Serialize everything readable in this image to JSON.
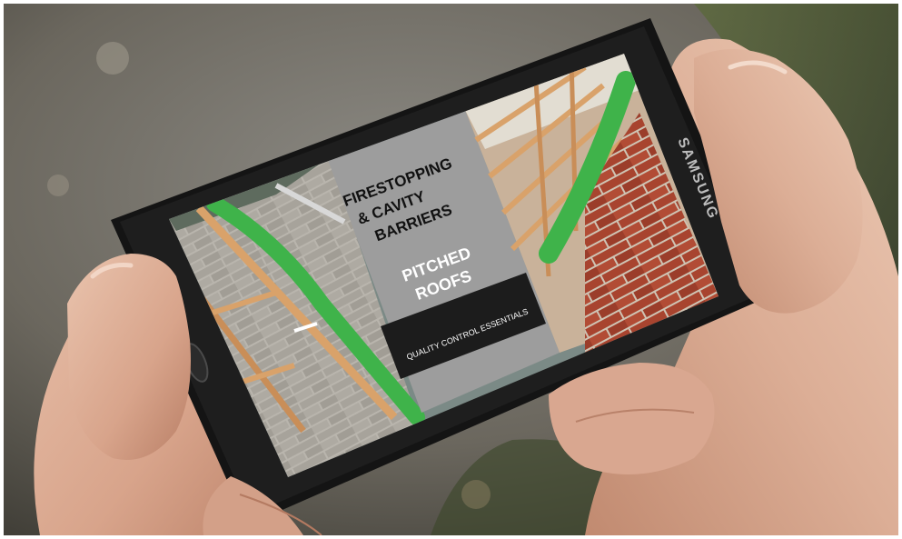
{
  "photo": {
    "phone_brand": "SAMSUNG",
    "slide": {
      "heading_line_1": "FIRESTOPPING",
      "heading_line_2": "& CAVITY",
      "heading_line_3": "BARRIERS",
      "subheading_line_1": "PITCHED",
      "subheading_line_2": "ROOFS",
      "tag": "QUALITY CONTROL ESSENTIALS"
    },
    "colors": {
      "panel_gray": "#9d9d9d",
      "tag_black": "#1c1c1c",
      "membrane_green": "#3fb34a",
      "brick_red": "#a8442f",
      "timber": "#d9a26a",
      "phone_body": "#141414"
    }
  }
}
